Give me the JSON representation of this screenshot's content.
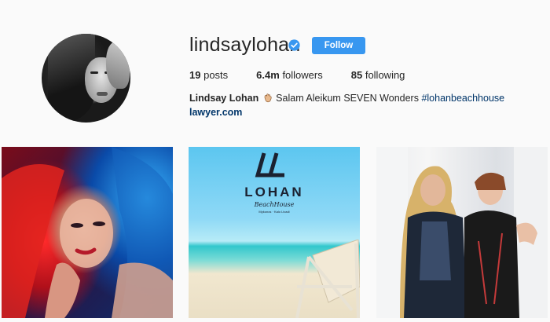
{
  "profile": {
    "username": "lindsaylohan",
    "verified": true,
    "follow_label": "Follow",
    "stats": {
      "posts_count": "19",
      "posts_label": "posts",
      "followers_count": "6.4m",
      "followers_label": "followers",
      "following_count": "85",
      "following_label": "following"
    },
    "bio": {
      "full_name": "Lindsay Lohan",
      "emoji": "waving-hand-emoji",
      "text": "Salam Aleikum SEVEN Wonders",
      "hashtag": "#lohanbeachhouse",
      "link": "lawyer.com"
    }
  },
  "posts": {
    "p2": {
      "brand": "LOHAN",
      "script": "BeachHouse",
      "small_text": "Mykonos · Kalo Livadi"
    }
  },
  "colors": {
    "accent": "#3897f0",
    "link": "#003569",
    "background": "#fafafa",
    "text": "#262626"
  }
}
